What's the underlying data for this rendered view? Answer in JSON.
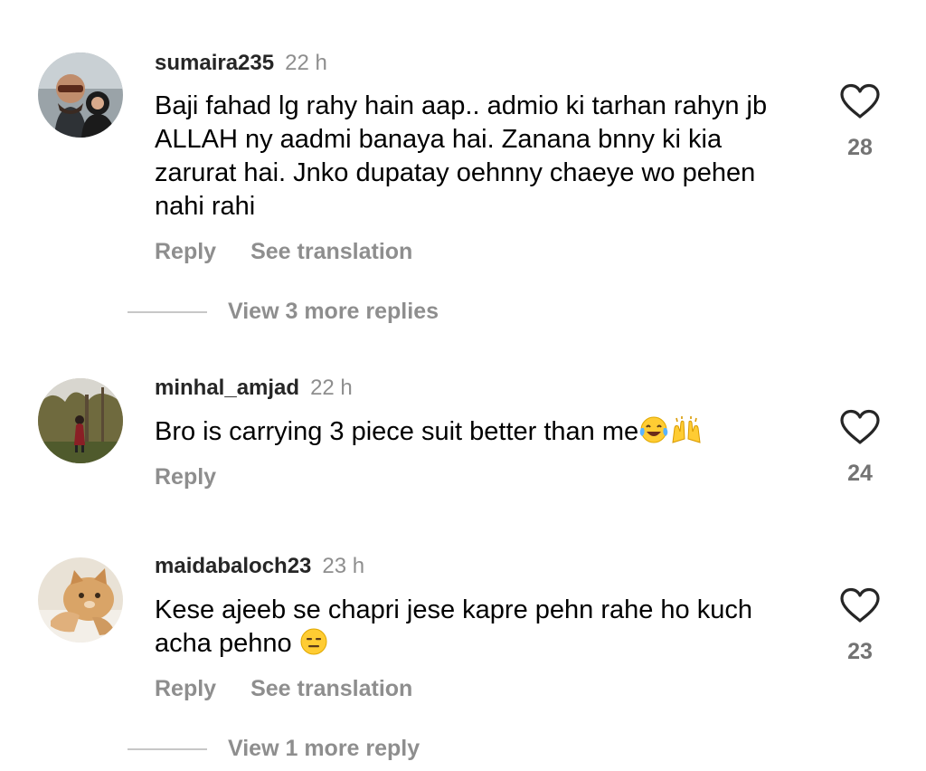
{
  "comments": [
    {
      "username": "sumaira235",
      "time": "22 h",
      "text": "Baji fahad lg rahy hain aap.. admio ki tarhan rahyn jb ALLAH ny aadmi banaya hai.  Zanana bnny ki kia zarurat hai. Jnko dupatay oehnny chaeye wo pehen nahi rahi",
      "reply_label": "Reply",
      "translate_label": "See translation",
      "likes": "28",
      "view_replies": "View 3 more replies",
      "avatar_icon": "couple-selfie-photo"
    },
    {
      "username": "minhal_amjad",
      "time": "22 h",
      "text": "Bro is carrying 3 piece suit better than me",
      "emojis": [
        "face-with-tears-of-joy",
        "raising-hands"
      ],
      "reply_label": "Reply",
      "likes": "24",
      "avatar_icon": "person-among-trees-photo"
    },
    {
      "username": "maidabaloch23",
      "time": "23 h",
      "text": "Kese ajeeb se chapri jese kapre pehn rahe ho kuch acha pehno",
      "emojis": [
        "expressionless-face"
      ],
      "reply_label": "Reply",
      "translate_label": "See translation",
      "likes": "23",
      "view_replies": "View 1 more reply",
      "avatar_icon": "cat-photo"
    }
  ],
  "colors": {
    "username": "#262626",
    "secondary_text": "#8e8e8e",
    "count": "#737373",
    "heart_stroke": "#262626",
    "divider": "#c7c7c7"
  },
  "icons": {
    "like": "heart-outline-icon"
  }
}
